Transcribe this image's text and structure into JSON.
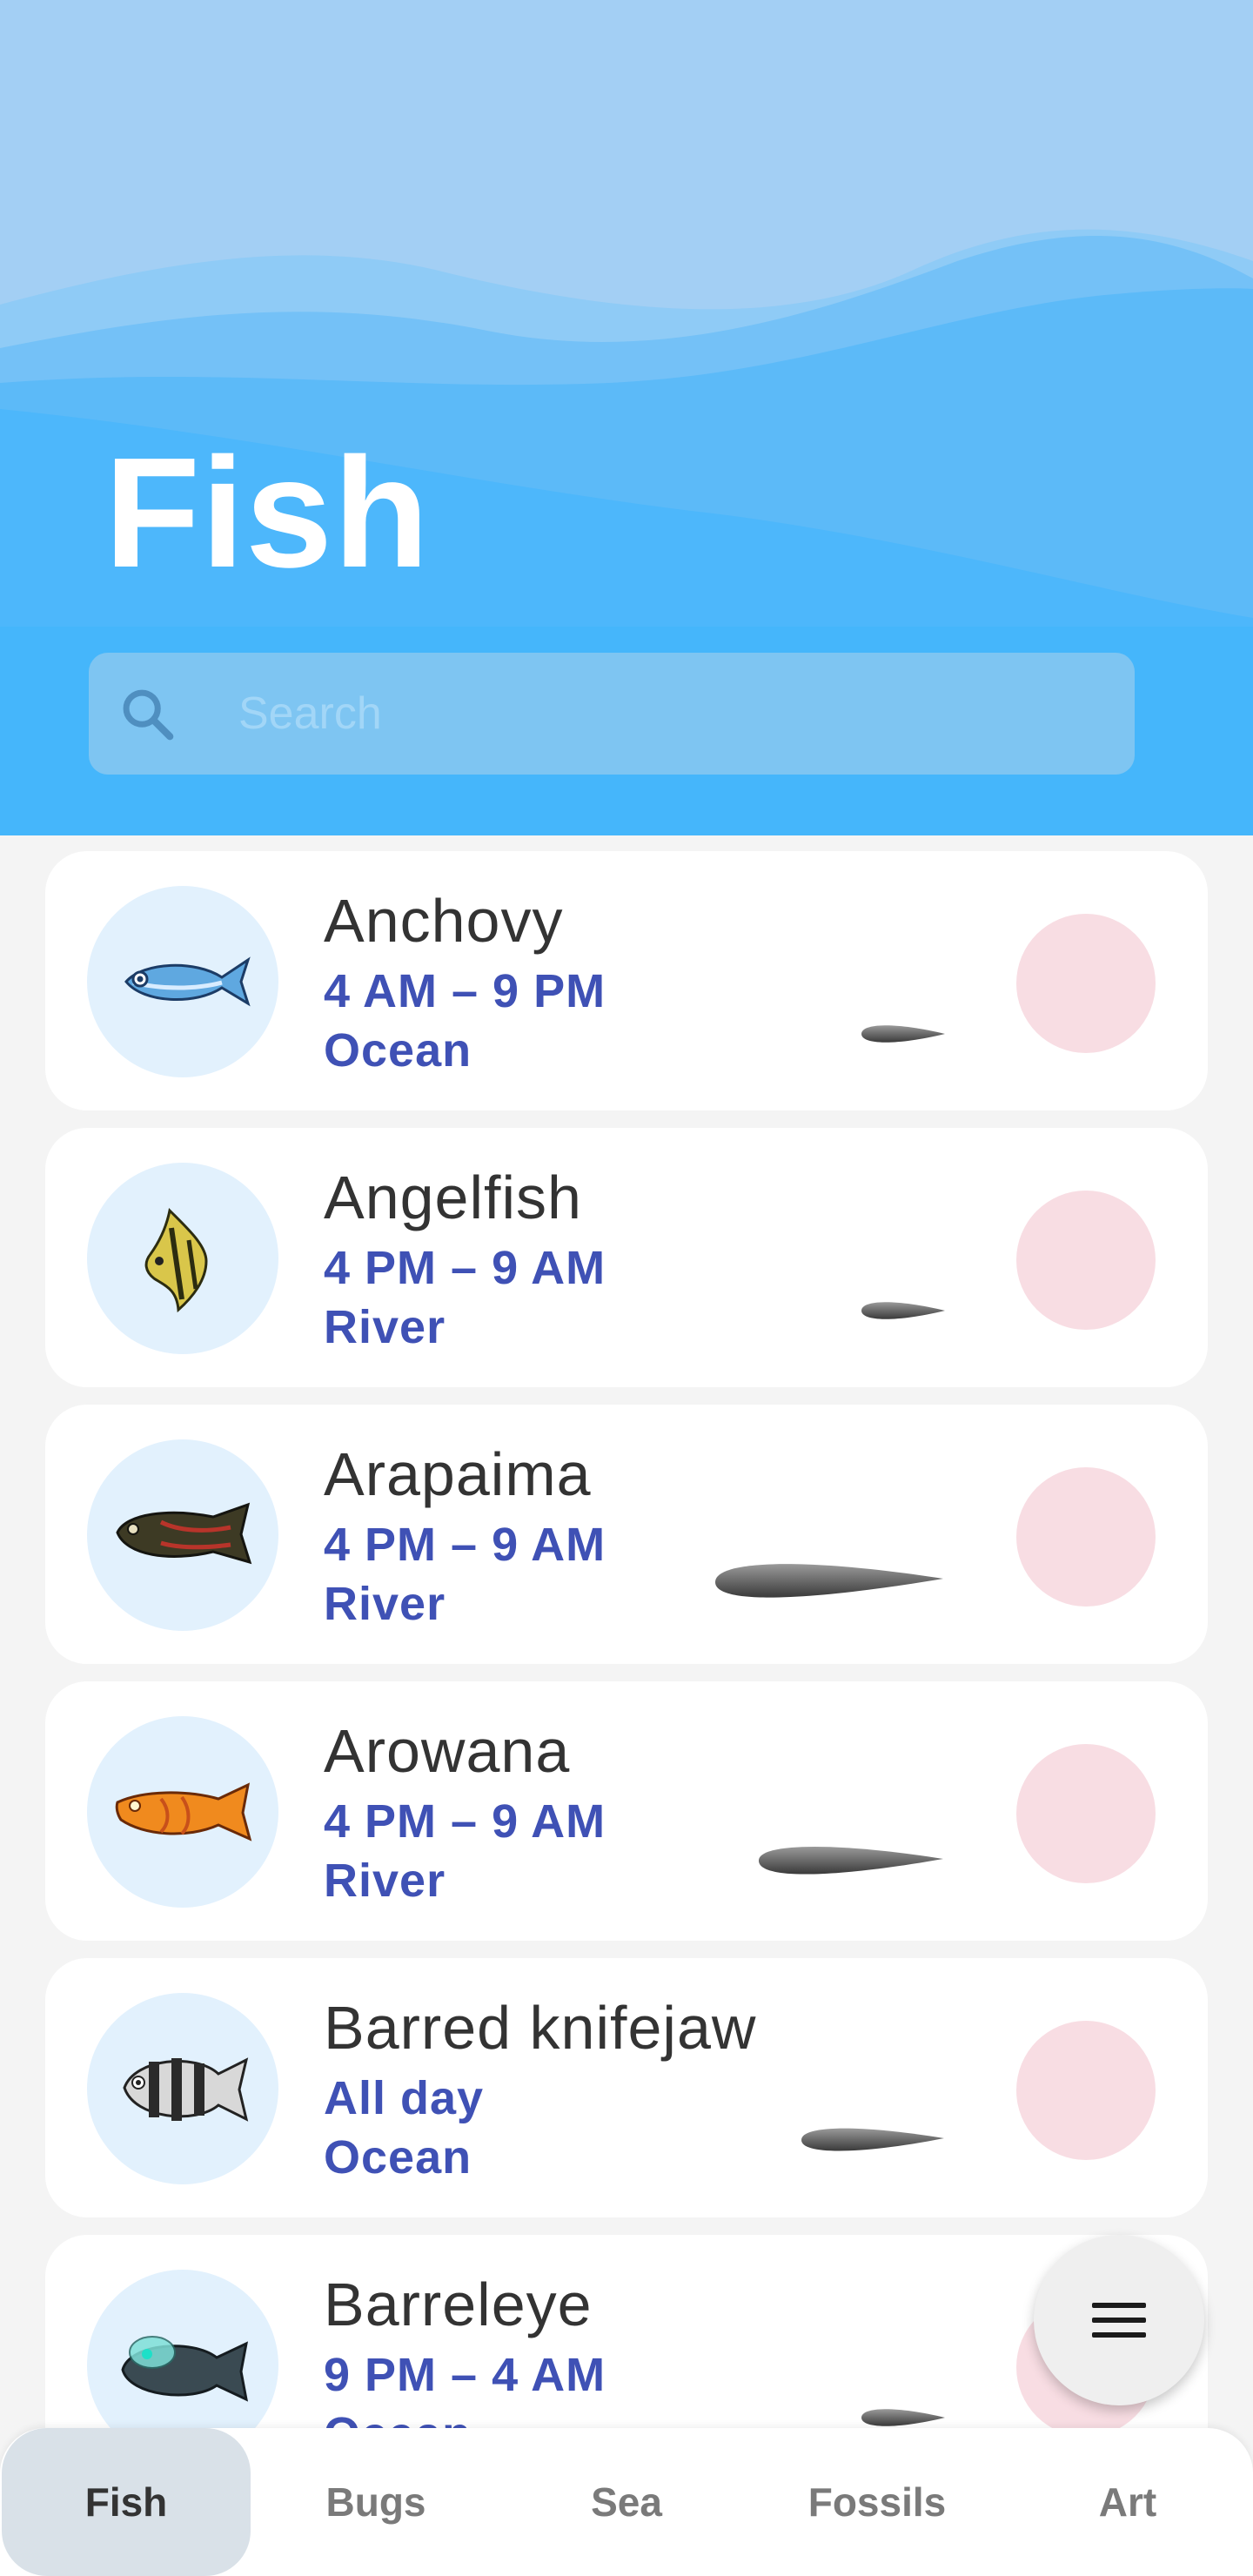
{
  "header": {
    "title": "Fish",
    "search_placeholder": "Search",
    "search_value": ""
  },
  "colors": {
    "header_sky": "#a3cff4",
    "header_water": "#45b6fb",
    "name_text": "#333333",
    "detail_text": "#3f51b5",
    "thumb_bg": "#e2f1fd",
    "status_dot": "#f8dde3",
    "active_tab_bg": "#d9e1e8"
  },
  "list": {
    "items": [
      {
        "name": "Anchovy",
        "time": "4 AM – 9 PM",
        "location": "Ocean",
        "icon": "anchovy-icon",
        "shadow_size": "small"
      },
      {
        "name": "Angelfish",
        "time": "4 PM – 9 AM",
        "location": "River",
        "icon": "angelfish-icon",
        "shadow_size": "small"
      },
      {
        "name": "Arapaima",
        "time": "4 PM – 9 AM",
        "location": "River",
        "icon": "arapaima-icon",
        "shadow_size": "extra-large"
      },
      {
        "name": "Arowana",
        "time": "4 PM – 9 AM",
        "location": "River",
        "icon": "arowana-icon",
        "shadow_size": "large"
      },
      {
        "name": "Barred knifejaw",
        "time": "All day",
        "location": "Ocean",
        "icon": "barred-knifejaw-icon",
        "shadow_size": "medium"
      },
      {
        "name": "Barreleye",
        "time": "9 PM – 4 AM",
        "location": "Ocean",
        "icon": "barreleye-icon",
        "shadow_size": "small"
      }
    ]
  },
  "fab": {
    "icon": "menu-icon"
  },
  "bottom_nav": {
    "tabs": [
      {
        "label": "Fish",
        "active": true
      },
      {
        "label": "Bugs",
        "active": false
      },
      {
        "label": "Sea",
        "active": false
      },
      {
        "label": "Fossils",
        "active": false
      },
      {
        "label": "Art",
        "active": false
      }
    ]
  }
}
